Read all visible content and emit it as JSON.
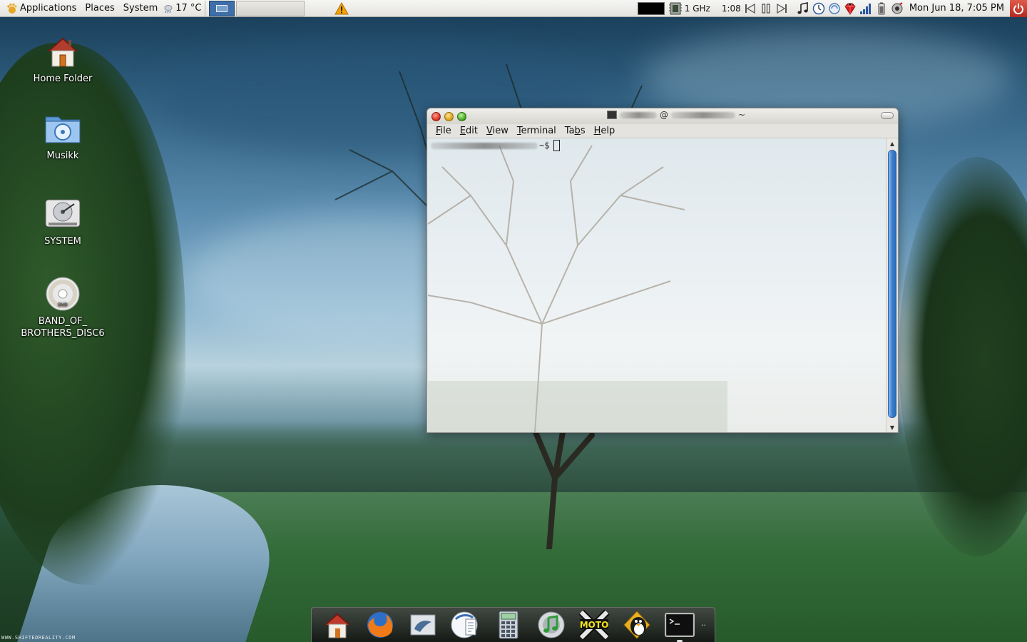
{
  "top_panel": {
    "menus": {
      "applications": "Applications",
      "places": "Places",
      "system": "System"
    },
    "weather": "17 °C",
    "cpu_freq": "1 GHz",
    "media_time": "1:08",
    "clock": "Mon Jun 18,  7:05 PM",
    "icons": [
      "gnome-foot-icon",
      "weather-icon",
      "workspace-switcher-icon",
      "warning-icon",
      "cpu-monitor-graph",
      "memory-icon",
      "previous-track-icon",
      "pause-icon",
      "next-track-icon",
      "music-note-icon",
      "clock-applet-icon",
      "update-icon",
      "ruby-icon",
      "signal-strength-icon",
      "battery-icon",
      "network-icon",
      "power-icon"
    ]
  },
  "desktop": {
    "icons": [
      {
        "label": "Home Folder",
        "icon": "home-folder-icon"
      },
      {
        "label": "Musikk",
        "icon": "music-folder-icon"
      },
      {
        "label": "SYSTEM",
        "icon": "hard-drive-icon"
      },
      {
        "label": "BAND_OF_",
        "label2": "BROTHERS_DISC6",
        "icon": "dvd-icon"
      }
    ],
    "watermark": "WWW.SHIFTEDREALITY.COM"
  },
  "terminal": {
    "title_at": "@",
    "title_tilde": "~",
    "menu": [
      "File",
      "Edit",
      "View",
      "Terminal",
      "Tabs",
      "Help"
    ],
    "menu_mnemonics": [
      "F",
      "E",
      "V",
      "T",
      "b",
      "H"
    ],
    "prompt_suffix": "~$"
  },
  "dock": {
    "items": [
      "home-icon",
      "firefox-icon",
      "mail-icon",
      "office-writer-icon",
      "calculator-icon",
      "music-player-icon",
      "moto-game-icon",
      "pidgin-icon",
      "terminal-icon"
    ]
  },
  "colors": {
    "panel_bg": "#e9e8e4",
    "workspace_active": "#3e6fa8",
    "scroll_thumb": "#3b7fd0",
    "power_button": "#c43a2b"
  }
}
